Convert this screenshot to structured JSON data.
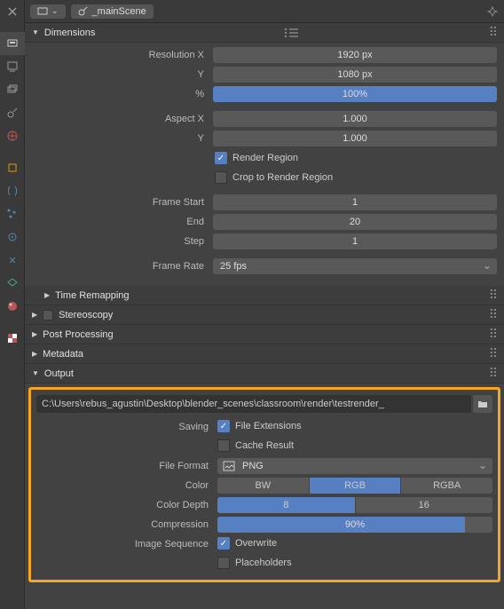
{
  "header": {
    "scene_name": "_mainScene"
  },
  "panels": {
    "dimensions": {
      "title": "Dimensions",
      "res_x_label": "Resolution X",
      "res_x": "1920 px",
      "res_y_label": "Y",
      "res_y": "1080 px",
      "pct_label": "%",
      "pct": "100%",
      "asp_x_label": "Aspect X",
      "asp_x": "1.000",
      "asp_y_label": "Y",
      "asp_y": "1.000",
      "render_region": "Render Region",
      "crop": "Crop to Render Region",
      "fstart_label": "Frame Start",
      "fstart": "1",
      "fend_label": "End",
      "fend": "20",
      "fstep_label": "Step",
      "fstep": "1",
      "rate_label": "Frame Rate",
      "rate": "25 fps"
    },
    "time_remapping": "Time Remapping",
    "stereoscopy": "Stereoscopy",
    "post_processing": "Post Processing",
    "metadata": "Metadata",
    "output": {
      "title": "Output",
      "path": "C:\\Users\\rebus_agustin\\Desktop\\blender_scenes\\classroom\\render\\testrender_",
      "saving_label": "Saving",
      "file_ext": "File Extensions",
      "cache": "Cache Result",
      "ff_label": "File Format",
      "ff": "PNG",
      "color_label": "Color",
      "color_opts": [
        "BW",
        "RGB",
        "RGBA"
      ],
      "depth_label": "Color Depth",
      "depth_opts": [
        "8",
        "16"
      ],
      "comp_label": "Compression",
      "comp": "90%",
      "comp_pct": 90,
      "seq_label": "Image Sequence",
      "overwrite": "Overwrite",
      "placeholders": "Placeholders"
    }
  }
}
